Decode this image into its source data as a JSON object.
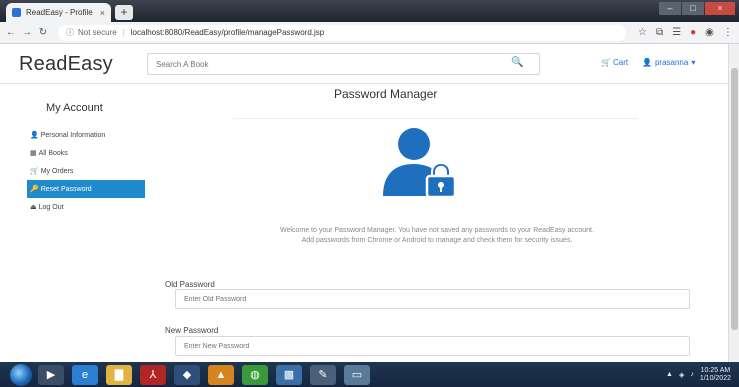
{
  "browser": {
    "tab_title": "ReadEasy - Profile",
    "tab_close": "×",
    "new_tab": "+",
    "window_buttons": {
      "minimize": "–",
      "maximize": "□",
      "close": "×"
    },
    "nav": {
      "back": "←",
      "forward": "→",
      "reload": "↻",
      "info": "ⓘ"
    },
    "address": {
      "site_label": "Not secure",
      "url": "localhost:8080/ReadEasy/profile/managePassword.jsp"
    }
  },
  "site": {
    "brand": "ReadEasy",
    "search_placeholder": "Search A Book",
    "cart_label": "Cart",
    "user_label": "prasanna"
  },
  "sidebar": {
    "title": "My Account",
    "items": [
      {
        "label": "Personal Information",
        "icon": "user-icon",
        "glyph": "👤",
        "active": false
      },
      {
        "label": "All Books",
        "icon": "book-icon",
        "glyph": "▦",
        "active": false
      },
      {
        "label": "My Orders",
        "icon": "cart-icon",
        "glyph": "🛒",
        "active": false
      },
      {
        "label": "Reset Password",
        "icon": "key-icon",
        "glyph": "🔑",
        "active": true
      },
      {
        "label": "Log Out",
        "icon": "logout-icon",
        "glyph": "⏏",
        "active": false
      }
    ]
  },
  "main": {
    "title": "Password Manager",
    "welcome_line1": "Welcome to your Password Manager. You have not saved any passwords to your ReadEasy account.",
    "welcome_line2": "Add passwords from Chrome or Android to manage and check them for security issues.",
    "old_password_label": "Old Password",
    "old_password_placeholder": "Enter Old Password",
    "new_password_label": "New Password",
    "new_password_placeholder": "Enter New Password"
  },
  "taskbar": {
    "clock_time": "10:25 AM",
    "clock_date": "1/10/2022"
  },
  "colors": {
    "accent": "#1f8bcd",
    "link": "#1e6fe0",
    "avatar": "#1f6fbf"
  }
}
